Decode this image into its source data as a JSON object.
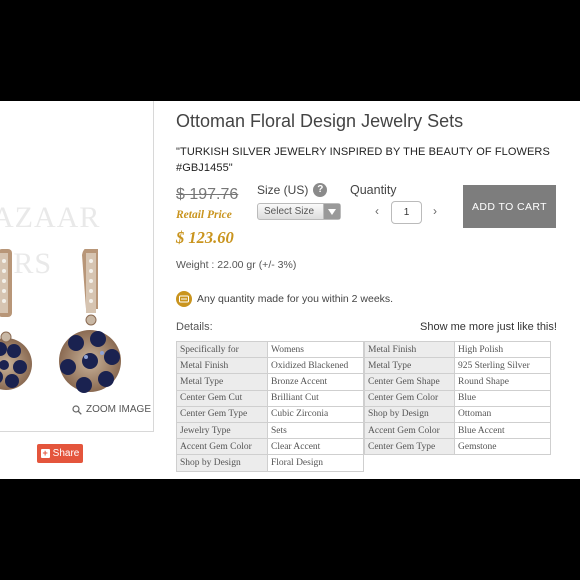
{
  "product": {
    "title": "Ottoman Floral Design Jewelry Sets",
    "description": "\"TURKISH SILVER JEWELRY INSPIRED BY THE BEAUTY OF FLOWERS #GBJ1455\"",
    "old_price": "$ 197.76",
    "retail_label": "Retail Price",
    "price": "$ 123.60",
    "weight": "Weight : 22.00 gr (+/- 3%)"
  },
  "image_panel": {
    "watermark_line1": "AZAAR",
    "watermark_line2": "ERS",
    "zoom_label": "ZOOM IMAGE",
    "share_label": "Share"
  },
  "options": {
    "size_label": "Size (US)",
    "size_help_icon": "?",
    "size_select_value": "Select Size",
    "quantity_label": "Quantity",
    "quantity_value": "1",
    "qty_dec": "‹",
    "qty_inc": "›",
    "add_to_cart": "ADD TO CART"
  },
  "notice": "Any quantity made for you within 2 weeks.",
  "details": {
    "label": "Details:",
    "show_more": "Show me more just like this!",
    "left_rows": [
      {
        "k": "Specifically for",
        "v": "Womens"
      },
      {
        "k": "Metal Finish",
        "v": "Oxidized Blackened"
      },
      {
        "k": "Metal Type",
        "v": "Bronze Accent"
      },
      {
        "k": "Center Gem Cut",
        "v": "Brilliant Cut"
      },
      {
        "k": "Center Gem Type",
        "v": "Cubic Zirconia"
      },
      {
        "k": "Jewelry Type",
        "v": "Sets"
      },
      {
        "k": "Accent Gem Color",
        "v": "Clear Accent"
      },
      {
        "k": "Shop by Design",
        "v": "Floral Design"
      }
    ],
    "right_rows": [
      {
        "k": "Metal Finish",
        "v": "High Polish"
      },
      {
        "k": "Metal Type",
        "v": "925 Sterling Silver"
      },
      {
        "k": "Center Gem Shape",
        "v": "Round Shape"
      },
      {
        "k": "Center Gem Color",
        "v": "Blue"
      },
      {
        "k": "Shop by Design",
        "v": "Ottoman"
      },
      {
        "k": "Accent Gem Color",
        "v": "Blue Accent"
      },
      {
        "k": "Center Gem Type",
        "v": "Gemstone"
      }
    ]
  },
  "icons": {
    "zoom": "magnifier-icon",
    "help": "question-icon",
    "select_arrow": "caret-down-icon",
    "notice": "clock-badge-icon",
    "share": "plus-icon"
  },
  "colors": {
    "price_gold": "#c9941e",
    "cart_button": "#7d7d7d",
    "share_button": "#e4553c",
    "sapphire": "#1a2250"
  }
}
